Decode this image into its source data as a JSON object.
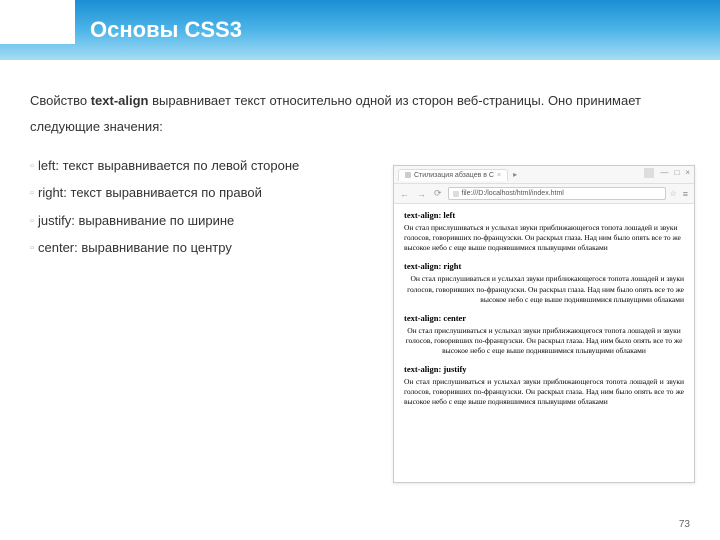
{
  "header": {
    "title": "Основы CSS3"
  },
  "intro": {
    "prefix": "Свойство ",
    "bold": "text-align",
    "suffix": " выравнивает текст относительно одной из сторон веб-страницы. Оно принимает следующие значения:"
  },
  "items": [
    "left: текст выравнивается по левой стороне",
    "right: текст выравнивается по правой",
    "justify: выравнивание по ширине",
    "center: выравнивание по центру"
  ],
  "browser": {
    "tab_title": "Стилизация абзацев в C",
    "url": "file:///D:/localhost/html/index.html",
    "win_ctrl": {
      "min": "—",
      "max": "□",
      "close": "×"
    },
    "sections": [
      {
        "h": "text-align: left",
        "cls": "t-left"
      },
      {
        "h": "text-align: right",
        "cls": "t-right"
      },
      {
        "h": "text-align: center",
        "cls": "t-center"
      },
      {
        "h": "text-align: justify",
        "cls": "t-justify"
      }
    ],
    "sample": "Он стал прислушиваться и услыхал звуки приближающегося топота лошадей и звуки голосов, говоривших по-французски. Он раскрыл глаза. Над ним было опять все то же высокое небо с еще выше поднявшимися плывущими облаками"
  },
  "page_num": "73"
}
